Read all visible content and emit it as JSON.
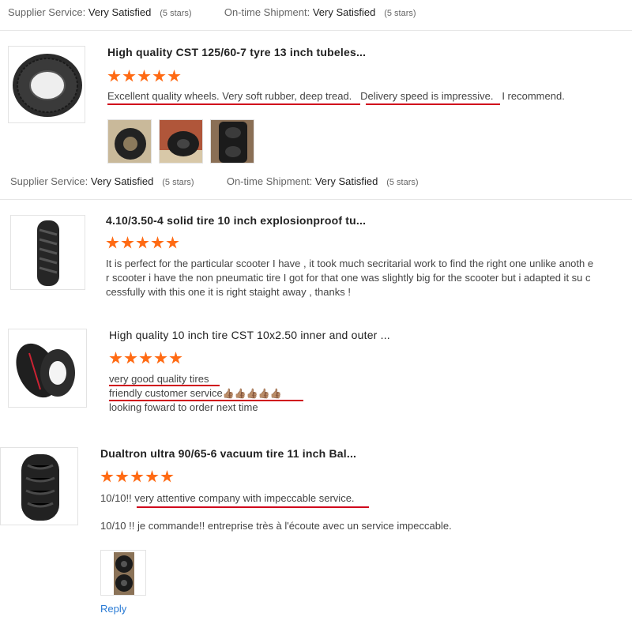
{
  "summary_top": {
    "supplier_label": "Supplier Service:",
    "supplier_value": "Very Satisfied",
    "supplier_stars": "(5 stars)",
    "shipment_label": "On-time Shipment:",
    "shipment_value": "Very Satisfied",
    "shipment_stars": "(5 stars)"
  },
  "reviews": [
    {
      "product_title": "High quality CST 125/60-7 tyre 13 inch tubeles...",
      "rating": 5,
      "text_parts": [
        "Excellent quality wheels.  Very soft rubber, deep tread.",
        "Delivery speed is impressive.",
        "I recommend."
      ],
      "summary": {
        "supplier_label": "Supplier Service:",
        "supplier_value": "Very Satisfied",
        "supplier_stars": "(5 stars)",
        "shipment_label": "On-time Shipment:",
        "shipment_value": "Very Satisfied",
        "shipment_stars": "(5 stars)"
      }
    },
    {
      "product_title": "4.10/3.50-4 solid tire 10 inch explosionproof tu...",
      "rating": 5,
      "text": "It is perfect for the particular scooter I have , it took much secritarial work to find the right one unlike anoth er scooter i have the non pneumatic tire I got for that one was slightly big for the scooter but i adapted it su ccessfully with this one it is right staight away , thanks !"
    },
    {
      "product_title": "High quality 10 inch tire CST 10x2.50 inner and outer ...",
      "rating": 5,
      "line1": "very good quality tires",
      "line2": "friendly customer service",
      "line2_emoji": "👍🏽👍🏽👍🏽👍🏽👍🏽",
      "line3": "looking foward to order next time"
    },
    {
      "product_title": "Dualtron ultra 90/65-6 vacuum tire 11 inch Bal...",
      "rating": 5,
      "text": "10/10!! very attentive company with impeccable service.",
      "translation": "10/10 !! je commande!! entreprise très à l'écoute avec un service impeccable.",
      "reply_label": "Reply"
    }
  ]
}
